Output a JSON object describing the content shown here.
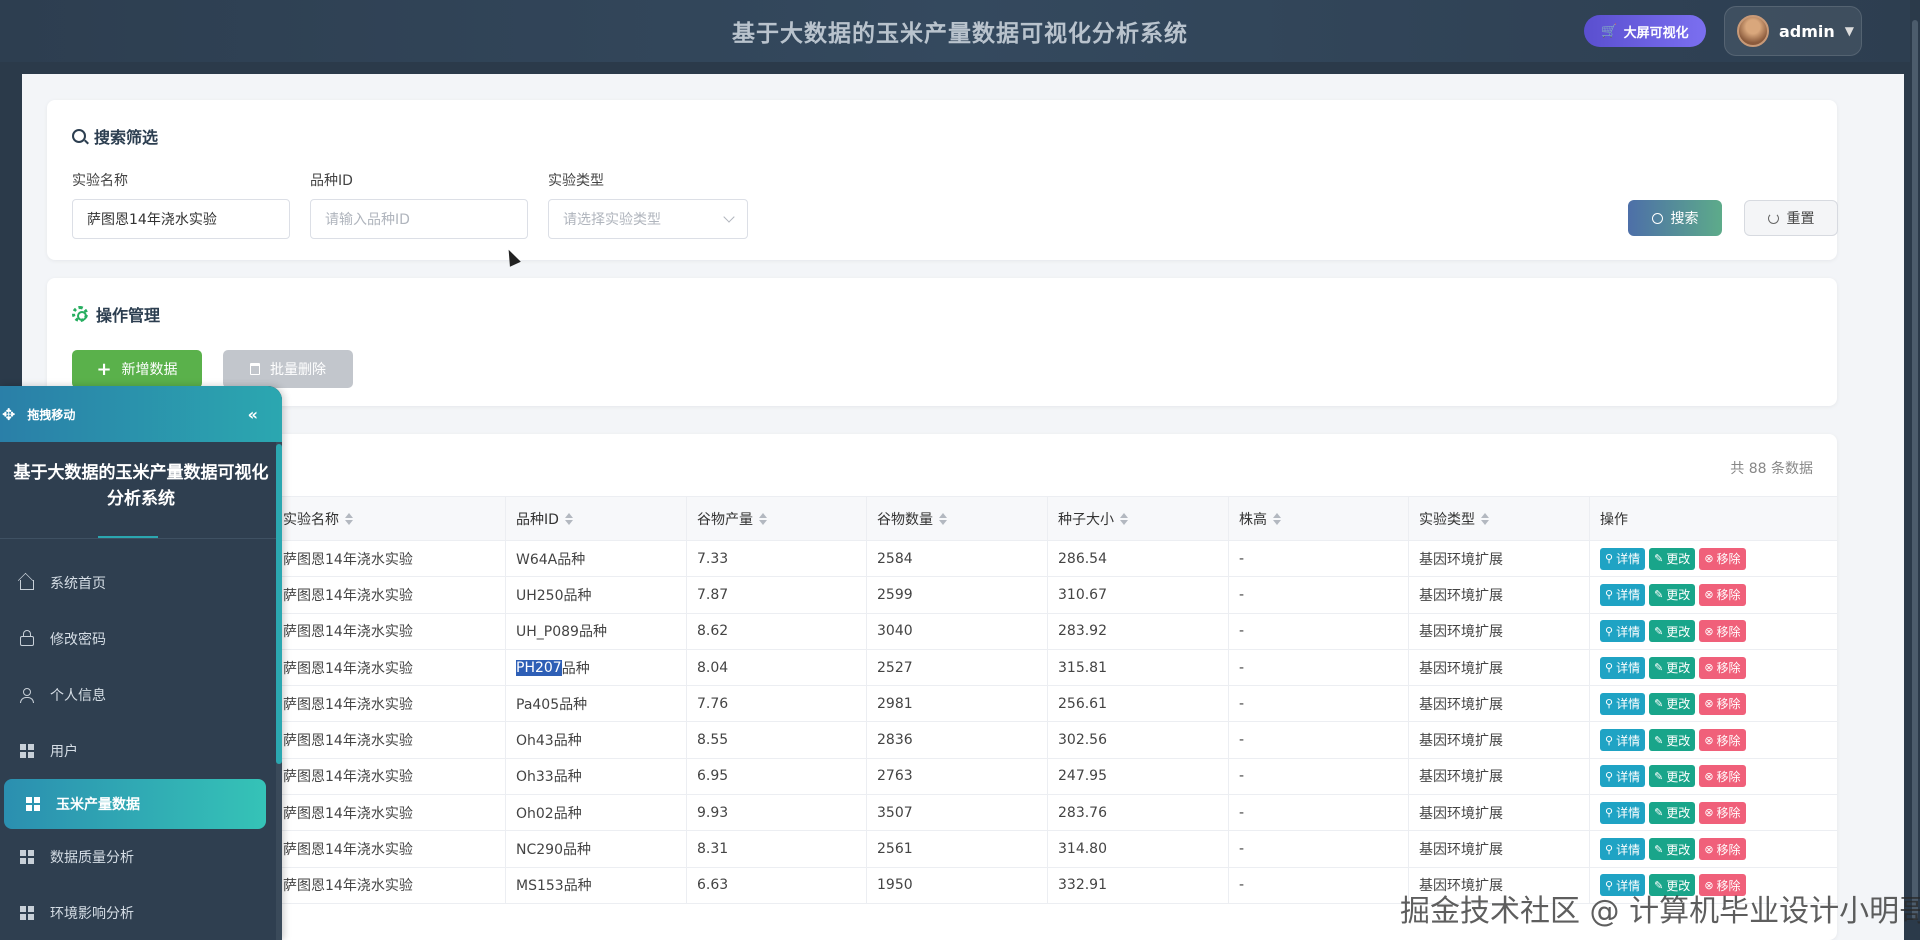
{
  "header": {
    "title": "基于大数据的玉米产量数据可视化分析系统",
    "big_screen_label": "大屏可视化",
    "user_name": "admin"
  },
  "search": {
    "heading": "搜索筛选",
    "fields": [
      {
        "label": "实验名称",
        "value": "萨图恩14年浇水实验",
        "placeholder": ""
      },
      {
        "label": "品种ID",
        "value": "",
        "placeholder": "请输入品种ID"
      },
      {
        "label": "实验类型",
        "value": "",
        "placeholder": "请选择实验类型"
      }
    ],
    "search_button": "搜索",
    "reset_button": "重置"
  },
  "ops": {
    "heading": "操作管理",
    "add_button": "新增数据",
    "bulk_delete_button": "批量删除"
  },
  "table": {
    "total_text": "共 88 条数据",
    "columns": [
      "实验名称",
      "品种ID",
      "谷物产量",
      "谷物数量",
      "种子大小",
      "株高",
      "实验类型",
      "操作"
    ],
    "action_labels": {
      "detail": "详情",
      "edit": "更改",
      "remove": "移除"
    },
    "rows": [
      [
        "萨图恩14年浇水实验",
        "W64A品种",
        "7.33",
        "2584",
        "286.54",
        "-",
        "基因环境扩展"
      ],
      [
        "萨图恩14年浇水实验",
        "UH250品种",
        "7.87",
        "2599",
        "310.67",
        "-",
        "基因环境扩展"
      ],
      [
        "萨图恩14年浇水实验",
        "UH_P089品种",
        "8.62",
        "3040",
        "283.92",
        "-",
        "基因环境扩展"
      ],
      [
        "萨图恩14年浇水实验",
        "PH207品种",
        "8.04",
        "2527",
        "315.81",
        "-",
        "基因环境扩展"
      ],
      [
        "萨图恩14年浇水实验",
        "Pa405品种",
        "7.76",
        "2981",
        "256.61",
        "-",
        "基因环境扩展"
      ],
      [
        "萨图恩14年浇水实验",
        "Oh43品种",
        "8.55",
        "2836",
        "302.56",
        "-",
        "基因环境扩展"
      ],
      [
        "萨图恩14年浇水实验",
        "Oh33品种",
        "6.95",
        "2763",
        "247.95",
        "-",
        "基因环境扩展"
      ],
      [
        "萨图恩14年浇水实验",
        "Oh02品种",
        "9.93",
        "3507",
        "283.76",
        "-",
        "基因环境扩展"
      ],
      [
        "萨图恩14年浇水实验",
        "NC290品种",
        "8.31",
        "2561",
        "314.80",
        "-",
        "基因环境扩展"
      ],
      [
        "萨图恩14年浇水实验",
        "MS153品种",
        "6.63",
        "1950",
        "332.91",
        "-",
        "基因环境扩展"
      ]
    ],
    "highlighted_text": "PH207"
  },
  "sidebar": {
    "drag_label": "拖拽移动",
    "collapse_icon": "«",
    "title": "基于大数据的玉米产量数据可视化分析系统",
    "items": [
      {
        "label": "系统首页",
        "icon": "home-icon"
      },
      {
        "label": "修改密码",
        "icon": "lock-icon"
      },
      {
        "label": "个人信息",
        "icon": "user-icon"
      },
      {
        "label": "用户",
        "icon": "grid-icon"
      },
      {
        "label": "玉米产量数据",
        "icon": "grid-icon",
        "active": true
      },
      {
        "label": "数据质量分析",
        "icon": "grid-icon"
      },
      {
        "label": "环境影响分析",
        "icon": "grid-icon"
      }
    ]
  },
  "watermark": "掘金技术社区 @ 计算机毕业设计小明哥",
  "colors": {
    "accent": "#2ba7b0",
    "add_green": "#5ab14b",
    "detail": "#1fa3c4",
    "edit": "#19a58a",
    "remove": "#f0607a"
  }
}
